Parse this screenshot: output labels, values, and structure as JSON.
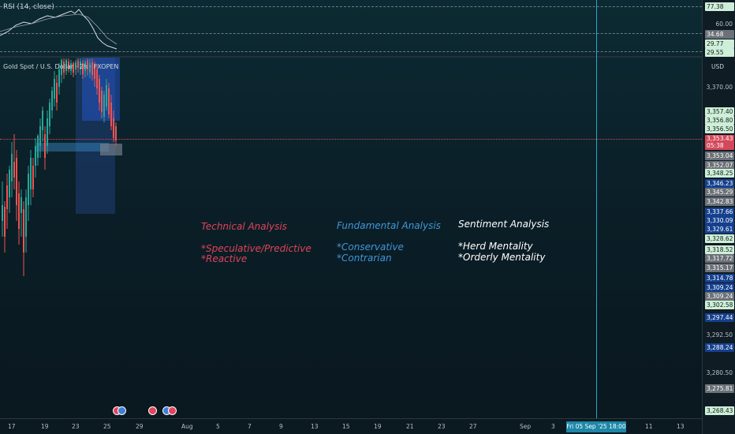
{
  "rsi": {
    "title": "RSI (14, close)",
    "levels": [
      "77.38",
      "60.00",
      "34.68",
      "29.77",
      "29.55"
    ]
  },
  "chart": {
    "title": "Gold Spot / U.S. Dollar · 2h · FXOPEN",
    "currency": "USD",
    "current_price": "3,353.43",
    "countdown": "05:38"
  },
  "price_axis": {
    "plain": [
      "3,370.00",
      "3,356.80",
      "3,292.50",
      "3,280.50"
    ],
    "labels": [
      {
        "text": "3,357.40",
        "bg": "#cfeed9",
        "fg": "#0b1f12"
      },
      {
        "text": "3,356.80",
        "bg": "#cfeed9",
        "fg": "#0b1f12"
      },
      {
        "text": "3,356.50",
        "bg": "#cfeed9",
        "fg": "#0b1f12"
      },
      {
        "text": "3,353.04",
        "bg": "#6b7177",
        "fg": "#ffffff"
      },
      {
        "text": "3,352.07",
        "bg": "#6b7177",
        "fg": "#ffffff"
      },
      {
        "text": "3,348.25",
        "bg": "#cfeed9",
        "fg": "#0b1f12"
      },
      {
        "text": "3,346.23",
        "bg": "#15408e",
        "fg": "#ffffff"
      },
      {
        "text": "3,345.29",
        "bg": "#6b7177",
        "fg": "#ffffff"
      },
      {
        "text": "3,342.83",
        "bg": "#6b7177",
        "fg": "#ffffff"
      },
      {
        "text": "3,337.66",
        "bg": "#15408e",
        "fg": "#ffffff"
      },
      {
        "text": "3,330.09",
        "bg": "#15408e",
        "fg": "#ffffff"
      },
      {
        "text": "3,329.61",
        "bg": "#15408e",
        "fg": "#ffffff"
      },
      {
        "text": "3,328.62",
        "bg": "#cfeed9",
        "fg": "#0b1f12"
      },
      {
        "text": "3,318.52",
        "bg": "#cfeed9",
        "fg": "#0b1f12"
      },
      {
        "text": "3,317.72",
        "bg": "#6b7177",
        "fg": "#ffffff"
      },
      {
        "text": "3,315.17",
        "bg": "#6b7177",
        "fg": "#ffffff"
      },
      {
        "text": "3,314.78",
        "bg": "#15408e",
        "fg": "#ffffff"
      },
      {
        "text": "3,309.24",
        "bg": "#15408e",
        "fg": "#ffffff"
      },
      {
        "text": "3,309.24",
        "bg": "#6b7177",
        "fg": "#ffffff"
      },
      {
        "text": "3,302.58",
        "bg": "#cfeed9",
        "fg": "#0b1f12"
      },
      {
        "text": "3,297.44",
        "bg": "#15408e",
        "fg": "#ffffff"
      },
      {
        "text": "3,288.24",
        "bg": "#15408e",
        "fg": "#ffffff"
      },
      {
        "text": "3,275.81",
        "bg": "#6b7177",
        "fg": "#ffffff"
      },
      {
        "text": "3,268.43",
        "bg": "#cfeed9",
        "fg": "#0b1f12"
      }
    ]
  },
  "time_axis": {
    "dates": [
      "17",
      "19",
      "23",
      "25",
      "29",
      "Aug",
      "5",
      "7",
      "9",
      "13",
      "15",
      "19",
      "21",
      "23",
      "27",
      "Sep",
      "3",
      "11",
      "13"
    ],
    "crosshair": "Fri 05 Sep '25   18:00"
  },
  "notes": {
    "technical": {
      "heading": "Technical Analysis",
      "line1": "*Speculative/Predictive",
      "line2": "*Reactive"
    },
    "fundamental": {
      "heading": "Fundamental Analysis",
      "line1": "*Conservative",
      "line2": "*Contrarian"
    },
    "sentiment": {
      "heading": "Sentiment Analysis",
      "line1": "*Herd Mentality",
      "line2": "*Orderly Mentality"
    }
  },
  "colors": {
    "bull": "#26a69a",
    "bear": "#ef5350",
    "crosshair": "#2aa6c6",
    "technical": "#e04358",
    "fundamental": "#3f97d8",
    "sentiment": "#ffffff"
  }
}
